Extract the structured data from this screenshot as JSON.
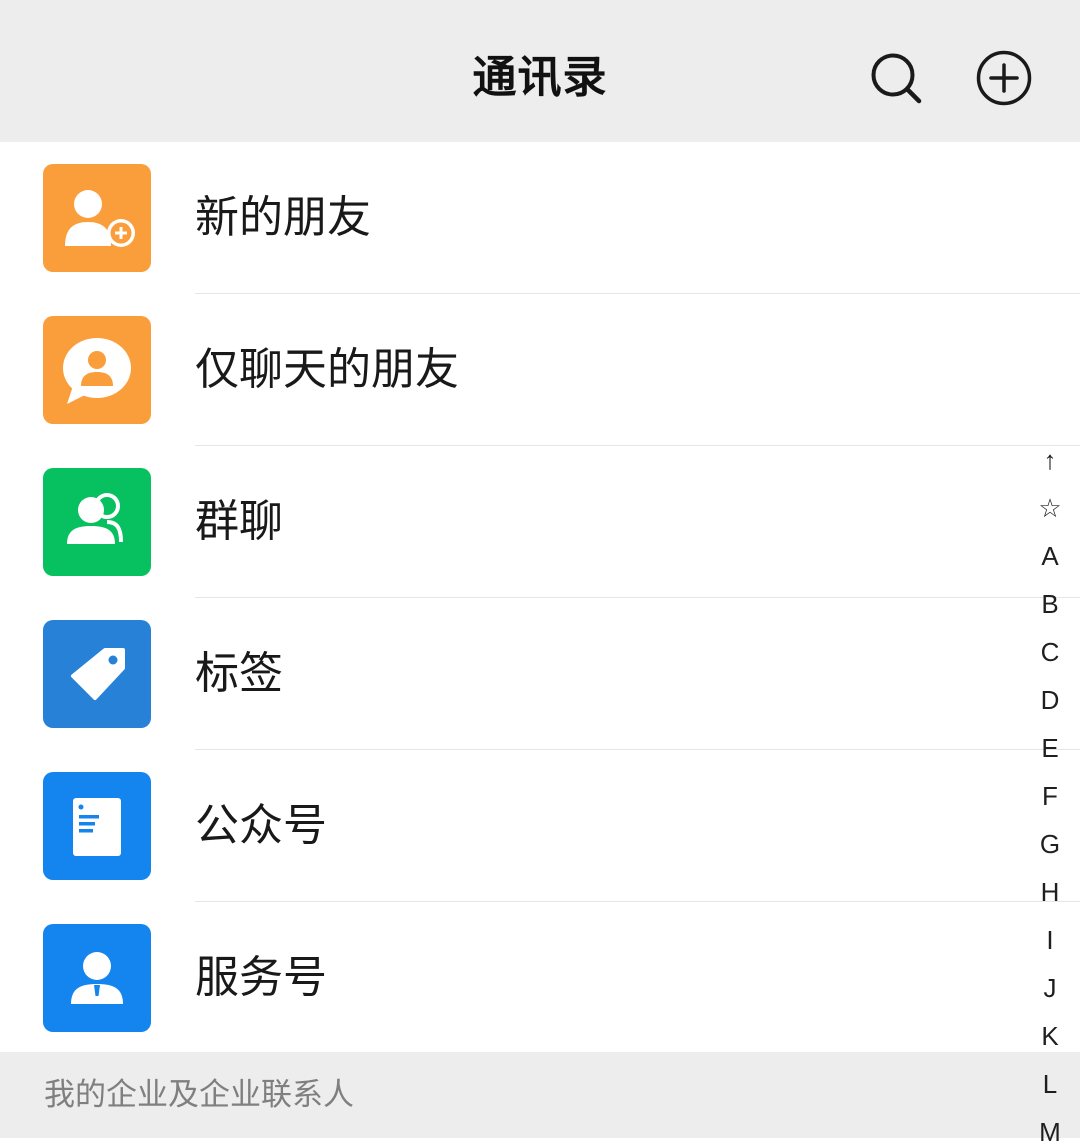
{
  "header": {
    "title": "通讯录"
  },
  "menu_items": [
    {
      "label": "新的朋友",
      "icon": "add-friend-icon",
      "color": "#fa9d3b"
    },
    {
      "label": "仅聊天的朋友",
      "icon": "chat-only-friend-icon",
      "color": "#fa9d3b"
    },
    {
      "label": "群聊",
      "icon": "group-chat-icon",
      "color": "#07c160"
    },
    {
      "label": "标签",
      "icon": "tag-icon",
      "color": "#2782d7"
    },
    {
      "label": "公众号",
      "icon": "official-account-icon",
      "color": "#1485ee"
    },
    {
      "label": "服务号",
      "icon": "service-account-icon",
      "color": "#1485ee"
    }
  ],
  "section": {
    "title": "我的企业及企业联系人"
  },
  "index_bar": [
    "↑",
    "☆",
    "A",
    "B",
    "C",
    "D",
    "E",
    "F",
    "G",
    "H",
    "I",
    "J",
    "K",
    "L",
    "M"
  ],
  "colors": {
    "header_bg": "#ededed",
    "text": "#191919",
    "section_text": "#7f7f7f"
  }
}
